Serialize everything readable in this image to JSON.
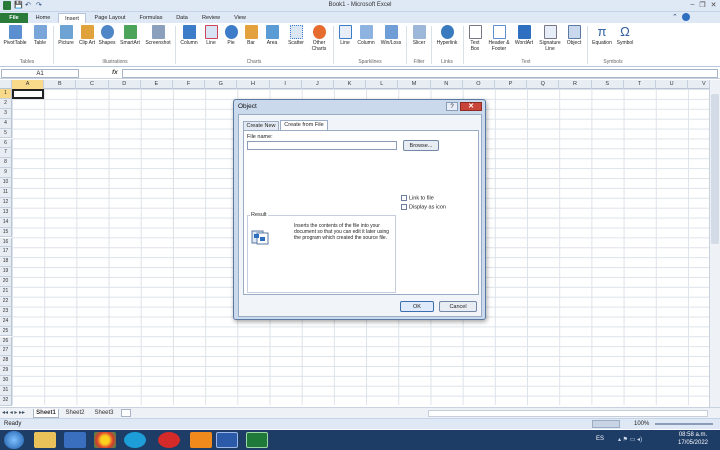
{
  "window": {
    "title": "Book1 - Microsoft Excel"
  },
  "tabs": [
    "File",
    "Home",
    "Insert",
    "Page Layout",
    "Formulas",
    "Data",
    "Review",
    "View"
  ],
  "active_tab": "Insert",
  "ribbon": {
    "tables": {
      "items": [
        "PivotTable",
        "Table"
      ],
      "label": "Tables"
    },
    "illustrations": {
      "items": [
        "Picture",
        "Clip Art",
        "Shapes",
        "SmartArt",
        "Screenshot"
      ],
      "label": "Illustrations"
    },
    "charts": {
      "items": [
        "Column",
        "Line",
        "Pie",
        "Bar",
        "Area",
        "Scatter",
        "Other Charts"
      ],
      "label": "Charts"
    },
    "sparklines": {
      "items": [
        "Line",
        "Column",
        "Win/Loss"
      ],
      "label": "Sparklines"
    },
    "filter": {
      "items": [
        "Slicer"
      ],
      "label": "Filter"
    },
    "links": {
      "items": [
        "Hyperlink"
      ],
      "label": "Links"
    },
    "text": {
      "items": [
        "Text Box",
        "Header & Footer",
        "WordArt",
        "Signature Line",
        "Object"
      ],
      "label": "Text"
    },
    "symbols": {
      "items": [
        "Equation",
        "Symbol"
      ],
      "label": "Symbols"
    }
  },
  "formula_bar": {
    "name_box": "A1",
    "fx": "fx",
    "value": ""
  },
  "columns": [
    "A",
    "B",
    "C",
    "D",
    "E",
    "F",
    "G",
    "H",
    "I",
    "J",
    "K",
    "L",
    "M",
    "N",
    "O",
    "P",
    "Q",
    "R",
    "S",
    "T",
    "U",
    "V"
  ],
  "rows": [
    "1",
    "2",
    "3",
    "4",
    "5",
    "6",
    "7",
    "8",
    "9",
    "10",
    "11",
    "12",
    "13",
    "14",
    "15",
    "16",
    "17",
    "18",
    "19",
    "20",
    "21",
    "22",
    "23",
    "24",
    "25",
    "26",
    "27",
    "28",
    "29",
    "30",
    "31",
    "32"
  ],
  "sheets": [
    "Sheet1",
    "Sheet2",
    "Sheet3"
  ],
  "active_sheet": "Sheet1",
  "status": {
    "left": "Ready",
    "zoom": "100%"
  },
  "clock": {
    "time": "08:58 a.m.",
    "date": "17/05/2022",
    "lang": "ES"
  },
  "dialog": {
    "title": "Object",
    "help": "?",
    "close": "✕",
    "tabs": [
      "Create New",
      "Create from File"
    ],
    "active_tab": "Create from File",
    "file_name_label": "File name:",
    "file_name_value": "",
    "browse_label": "Browse...",
    "link_to_file": "Link to file",
    "display_as_icon": "Display as icon",
    "result_label": "Result",
    "result_text": "Inserts the contents of the file into your document so that you can edit it later using the program which created the source file.",
    "ok_label": "OK",
    "cancel_label": "Cancel"
  },
  "colors": {
    "accent": "#2a7a3a",
    "taskbar": "#1d3c66",
    "close": "#c9453a"
  }
}
